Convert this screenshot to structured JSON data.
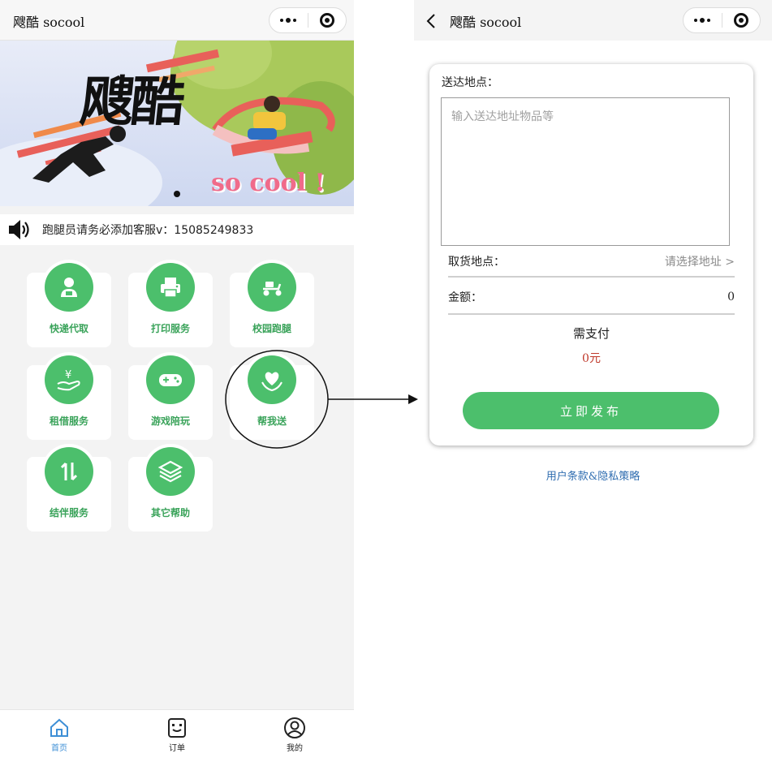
{
  "left": {
    "title": "飕酷 socool",
    "banner": {
      "headline": "飕酷",
      "tagline": "so cool !"
    },
    "notice": {
      "text": "跑腿员请务必添加客服v：15085249833"
    },
    "services": [
      {
        "label": "快递代取",
        "icon": "courier-person-icon"
      },
      {
        "label": "打印服务",
        "icon": "printer-icon"
      },
      {
        "label": "校园跑腿",
        "icon": "scooter-icon"
      },
      {
        "label": "租借服务",
        "icon": "yuan-hand-icon"
      },
      {
        "label": "游戏陪玩",
        "icon": "gamepad-icon"
      },
      {
        "label": "帮我送",
        "icon": "heart-hand-icon"
      },
      {
        "label": "结伴服务",
        "icon": "up-down-arrows-icon"
      },
      {
        "label": "其它帮助",
        "icon": "layers-icon"
      }
    ],
    "tabs": [
      {
        "label": "首页",
        "icon": "home-icon",
        "active": true
      },
      {
        "label": "订单",
        "icon": "order-icon",
        "active": false
      },
      {
        "label": "我的",
        "icon": "profile-icon",
        "active": false
      }
    ]
  },
  "right": {
    "title": "飕酷 socool",
    "form": {
      "address_label": "送达地点：",
      "address_placeholder": "输入送达地址物品等",
      "pickup_label": "取货地点：",
      "pickup_value": "请选择地址 >",
      "amount_label": "金额：",
      "amount_value": "0",
      "pay_label": "需支付",
      "pay_amount": "0元",
      "submit_label": "立即发布"
    },
    "terms_link": "用户条款&隐私策略"
  },
  "colors": {
    "primary_green": "#4cbf6c",
    "link_blue": "#2f6db0",
    "price_red": "#c0392b",
    "active_tab": "#3e8fd6"
  }
}
